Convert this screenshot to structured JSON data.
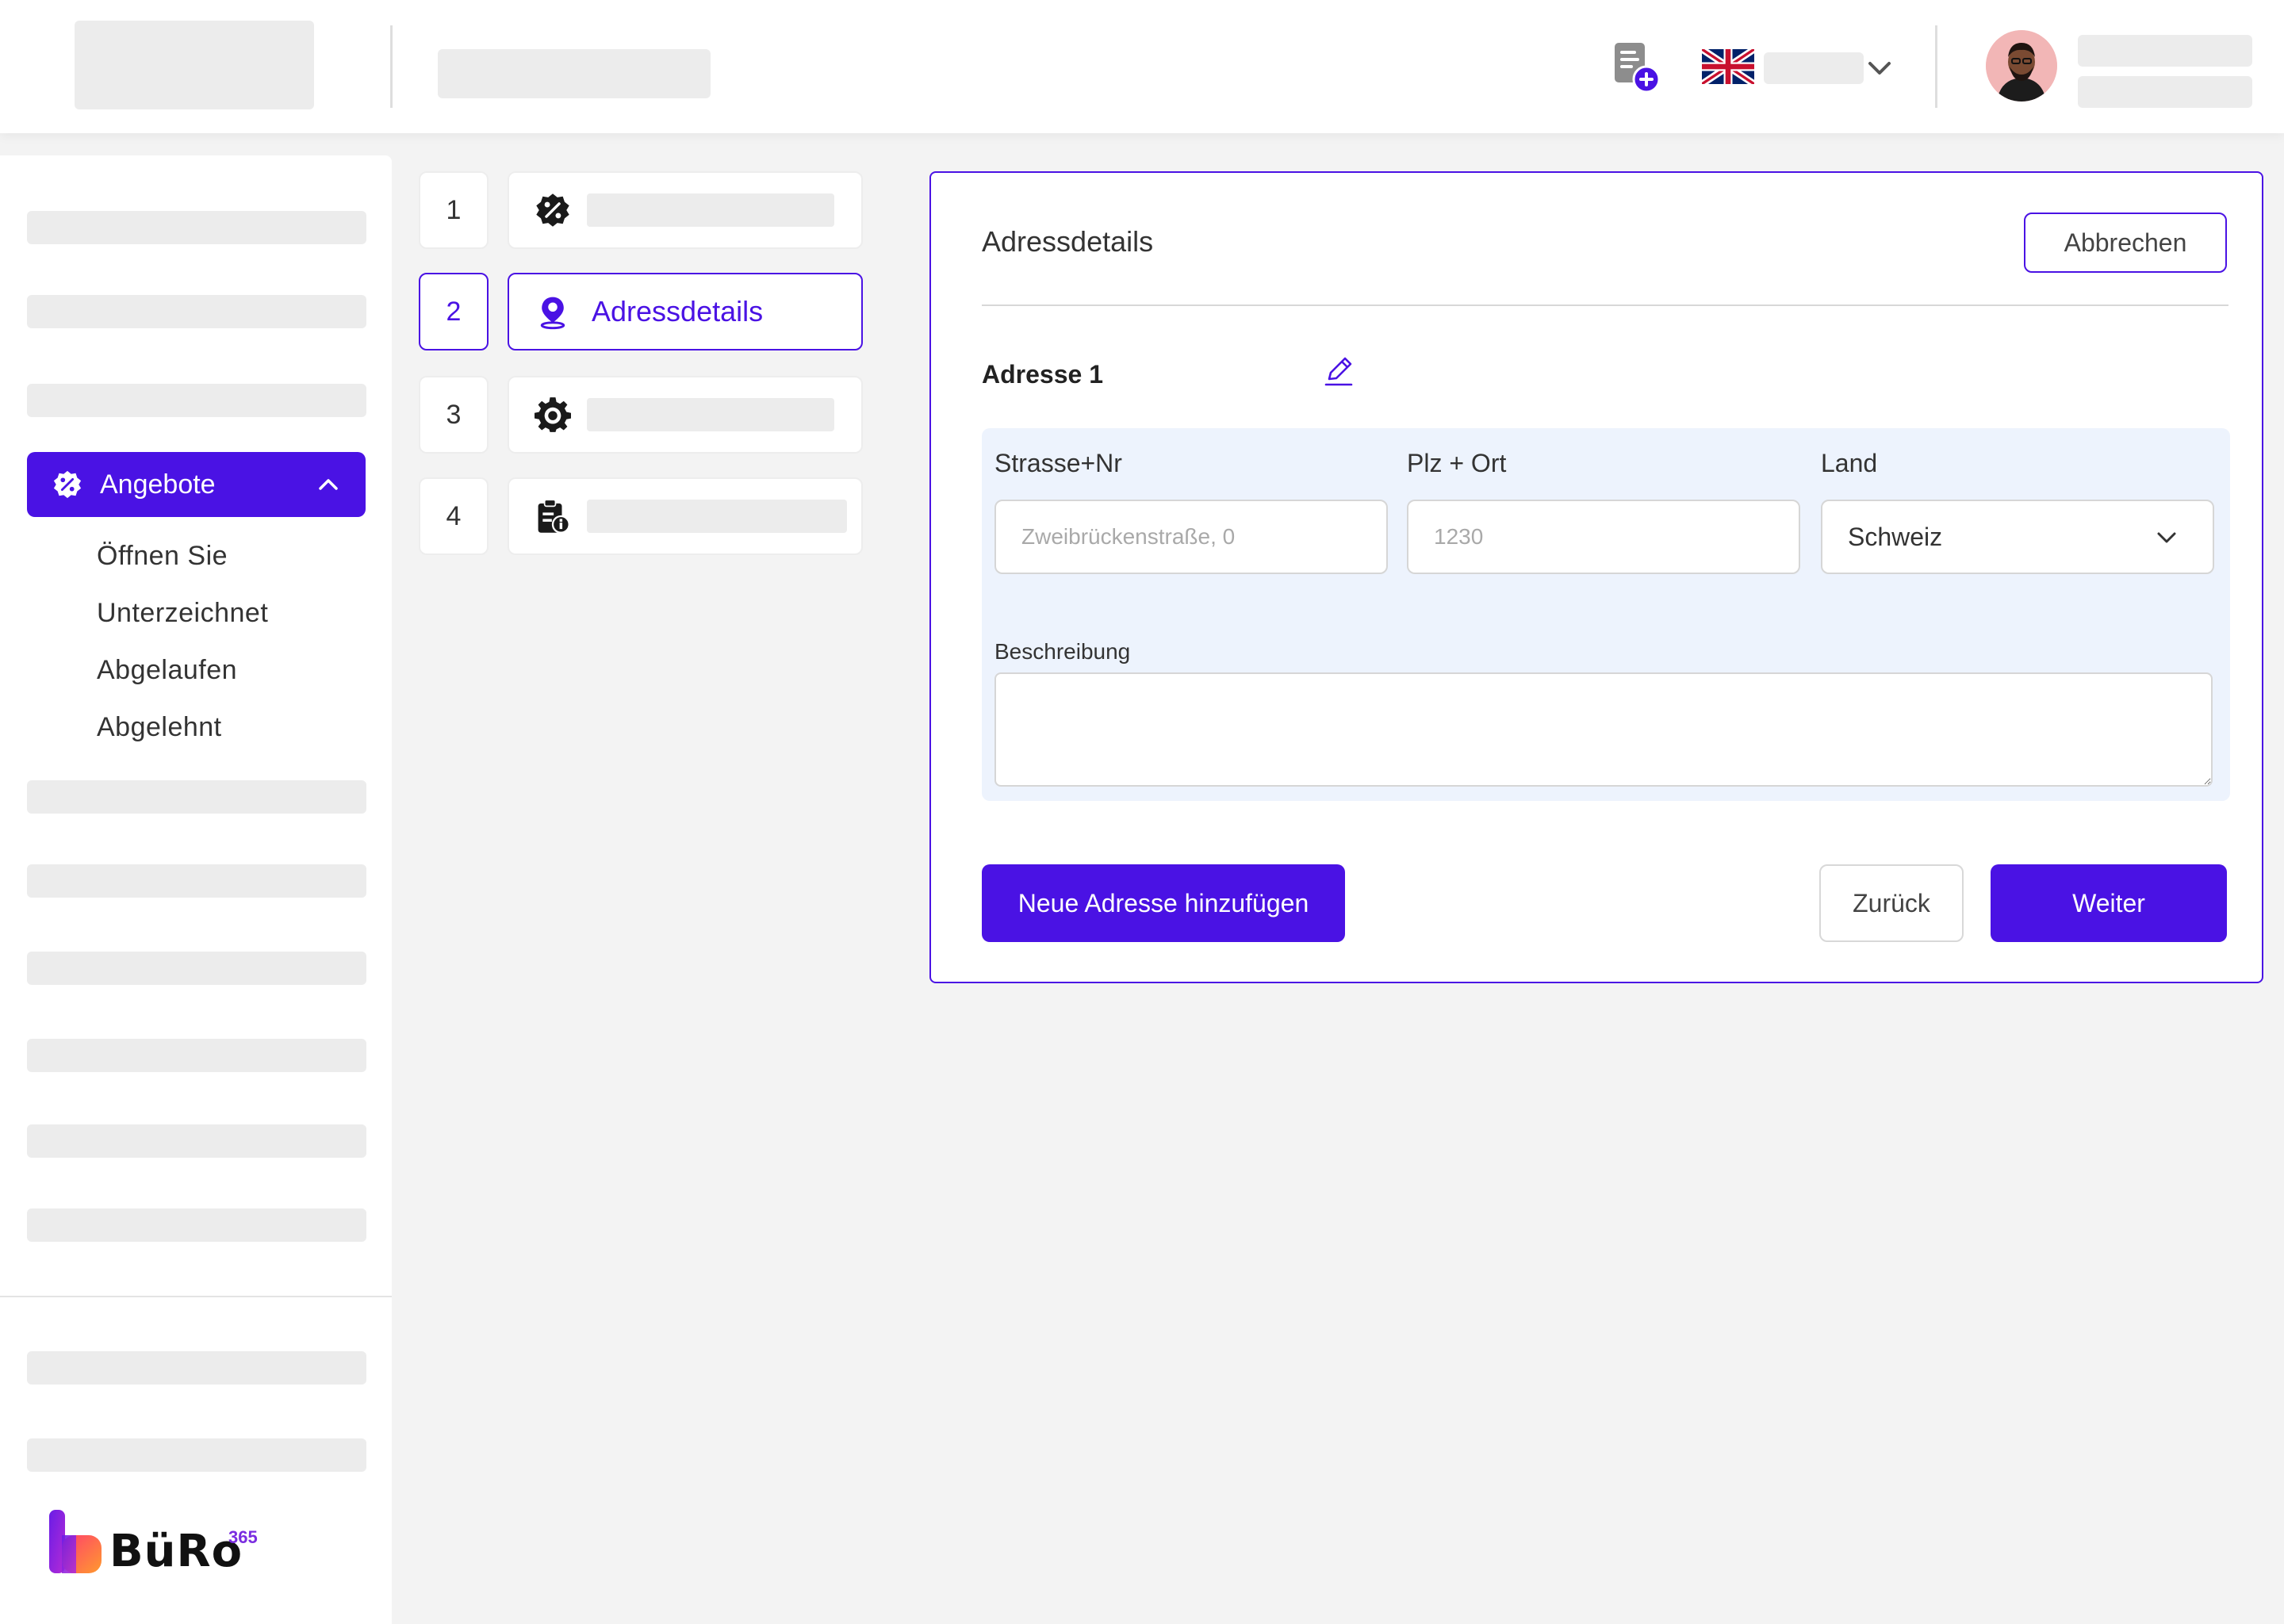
{
  "sidebar": {
    "active_item": {
      "label": "Angebote",
      "icon": "percent-badge-icon"
    },
    "sub_items": [
      "Öffnen Sie",
      "Unterzeichnet",
      "Abgelaufen",
      "Abgelehnt"
    ],
    "brand": {
      "name": "BüRo",
      "superscript": "365"
    }
  },
  "steps": [
    {
      "number": "1",
      "icon": "percent-badge-icon",
      "label": ""
    },
    {
      "number": "2",
      "icon": "location-pin-icon",
      "label": "Adressdetails",
      "active": true
    },
    {
      "number": "3",
      "icon": "settings-gear-icon",
      "label": ""
    },
    {
      "number": "4",
      "icon": "clipboard-info-icon",
      "label": ""
    }
  ],
  "form": {
    "title": "Adressdetails",
    "cancel_label": "Abbrechen",
    "address_heading": "Adresse 1",
    "street": {
      "label": "Strasse+Nr",
      "placeholder": "Zweibrückenstraße, 0",
      "value": ""
    },
    "zip_city": {
      "label": "Plz + Ort",
      "placeholder": "1230",
      "value": ""
    },
    "country": {
      "label": "Land",
      "value": "Schweiz"
    },
    "description": {
      "label": "Beschreibung",
      "value": ""
    },
    "add_address_label": "Neue Adresse hinzufügen",
    "back_label": "Zurück",
    "next_label": "Weiter"
  },
  "header": {
    "language_flag": "uk-flag-icon"
  },
  "colors": {
    "accent": "#4a12e4",
    "panel_bg": "#edf3fd",
    "page_bg": "#f3f3f3"
  }
}
